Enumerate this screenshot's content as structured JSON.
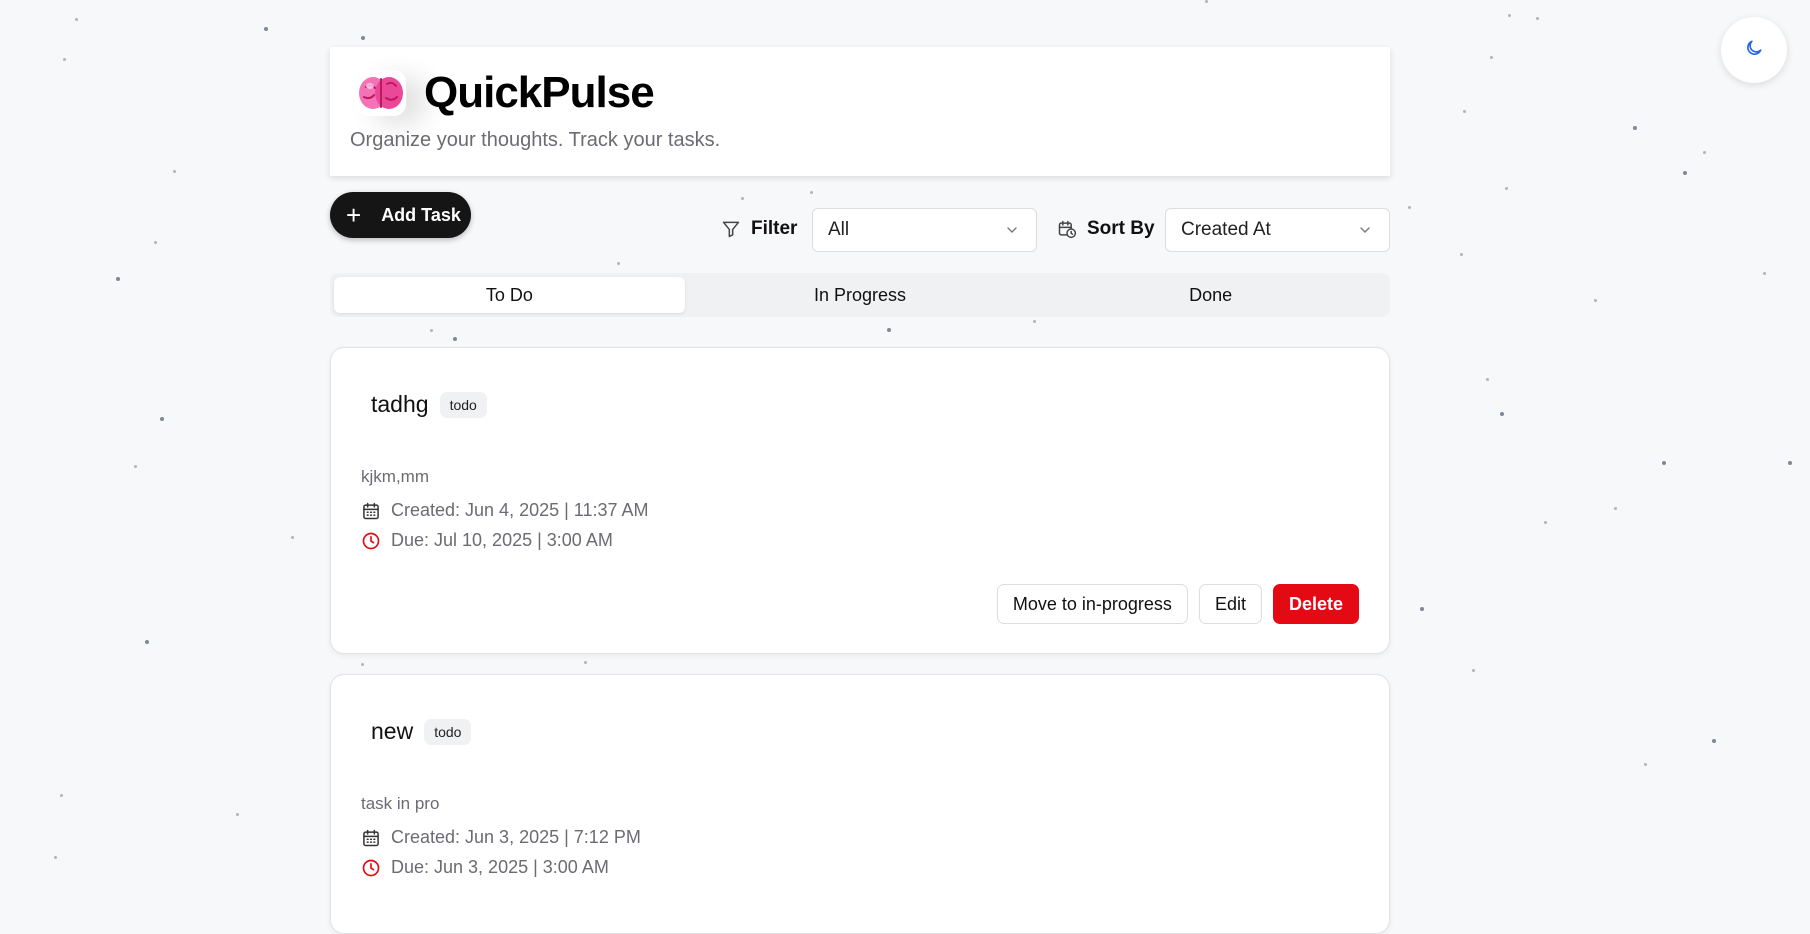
{
  "header": {
    "logo_icon": "brain-icon",
    "title": "QuickPulse",
    "tagline": "Organize your thoughts. Track your tasks."
  },
  "theme_toggle": {
    "icon": "moon-icon"
  },
  "toolbar": {
    "add_task_label": "Add Task",
    "filter_label": "Filter",
    "filter_value": "All",
    "sort_label": "Sort By",
    "sort_value": "Created At"
  },
  "tabs": [
    {
      "label": "To Do",
      "active": true
    },
    {
      "label": "In Progress",
      "active": false
    },
    {
      "label": "Done",
      "active": false
    }
  ],
  "tasks": [
    {
      "title": "tadhg",
      "status": "todo",
      "description": "kjkm,mm",
      "created": "Created: Jun 4, 2025 | 11:37 AM",
      "due": "Due: Jul 10, 2025 | 3:00 AM",
      "actions": {
        "move": "Move to in-progress",
        "edit": "Edit",
        "delete": "Delete"
      }
    },
    {
      "title": "new",
      "status": "todo",
      "description": "task in pro",
      "created": "Created: Jun 3, 2025 | 7:12 PM",
      "due": "Due: Jun 3, 2025 | 3:00 AM"
    }
  ],
  "colors": {
    "accent_dark": "#151515",
    "danger": "#e50914",
    "due_icon": "#e50914",
    "moon_icon": "#2563eb",
    "brain_pink": "#f472b6"
  }
}
